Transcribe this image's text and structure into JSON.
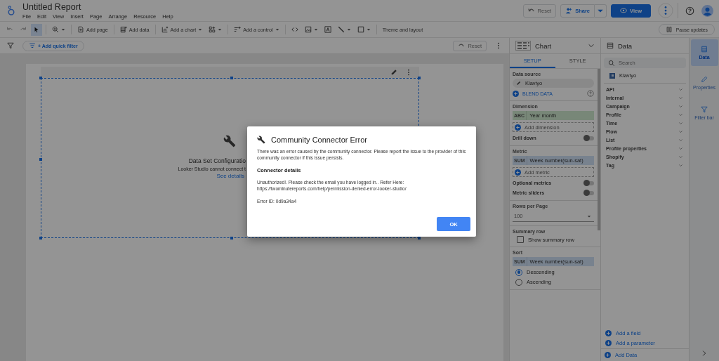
{
  "app": {
    "title": "Untitled Report",
    "menu": [
      "File",
      "Edit",
      "View",
      "Insert",
      "Page",
      "Arrange",
      "Resource",
      "Help"
    ],
    "reset": "Reset",
    "share": "Share",
    "view": "View"
  },
  "toolbar": {
    "items": [
      {
        "kind": "undo",
        "caret": false,
        "selected": false,
        "disabled": true
      },
      {
        "kind": "redo",
        "caret": false,
        "selected": false,
        "disabled": true
      },
      {
        "kind": "select",
        "caret": false,
        "selected": true,
        "disabled": false
      },
      {
        "kind": "zoom",
        "caret": true,
        "selected": false,
        "disabled": false
      },
      {
        "kind": "add_page",
        "label": "Add page",
        "caret": false,
        "selected": false,
        "disabled": false
      },
      {
        "kind": "add_data",
        "label": "Add data",
        "caret": false,
        "selected": false,
        "disabled": false
      },
      {
        "kind": "add_chart",
        "label": "Add a chart",
        "caret": true,
        "selected": false,
        "disabled": false
      },
      {
        "kind": "community",
        "caret": true,
        "selected": false,
        "disabled": false
      },
      {
        "kind": "add_control",
        "label": "Add a control",
        "caret": true,
        "selected": false,
        "disabled": false
      },
      {
        "kind": "embed",
        "caret": false,
        "selected": false,
        "disabled": false
      },
      {
        "kind": "image",
        "caret": true,
        "selected": false,
        "disabled": false
      },
      {
        "kind": "text",
        "caret": false,
        "selected": false,
        "disabled": false
      },
      {
        "kind": "line",
        "caret": true,
        "selected": false,
        "disabled": false
      },
      {
        "kind": "shape",
        "caret": true,
        "selected": false,
        "disabled": false
      },
      {
        "kind": "theme",
        "label": "Theme and layout",
        "caret": false,
        "selected": false,
        "disabled": false
      }
    ],
    "pause": "Pause updates"
  },
  "filter_bar": {
    "quick_filter": "+ Add quick filter",
    "reset": "Reset"
  },
  "canvas": {
    "chart": {
      "selected": true,
      "title": "Data Set Configuratio",
      "message": "Looker Studio cannot connect t",
      "link": "See details"
    }
  },
  "chart_panel": {
    "title": "Chart",
    "tabs": [
      {
        "label": "SETUP",
        "selected": true
      },
      {
        "label": "STYLE",
        "selected": false
      }
    ],
    "sections": [
      {
        "kind": "data_source",
        "heading": "Data source",
        "source": "Klaviyo",
        "blend": "BLEND DATA"
      },
      {
        "kind": "fields",
        "heading": "Dimension",
        "chips": [
          {
            "type": "ABC",
            "label": "Year month",
            "color": "#788778"
          }
        ],
        "add": "Add dimension",
        "toggles": [
          {
            "label": "Drill down",
            "on": false
          }
        ]
      },
      {
        "kind": "fields",
        "heading": "Metric",
        "chips": [
          {
            "type": "SUM",
            "label": "Week number(sun-sat)",
            "color": "#78828e"
          }
        ],
        "add": "Add metric",
        "toggles": [
          {
            "label": "Optional metrics",
            "on": false
          },
          {
            "label": "Metric sliders",
            "on": false
          }
        ]
      },
      {
        "kind": "select",
        "heading": "Rows per Page",
        "value": "100"
      },
      {
        "kind": "checkbox",
        "heading": "Summary row",
        "label": "Show summary row",
        "checked": false
      },
      {
        "kind": "sort",
        "heading": "Sort",
        "chip": {
          "type": "SUM",
          "label": "Week number(sun-sat)",
          "color": "#78828e"
        },
        "options": [
          {
            "label": "Descending",
            "selected": true
          },
          {
            "label": "Ascending",
            "selected": false
          }
        ]
      }
    ]
  },
  "data_panel": {
    "title": "Data",
    "search": {
      "placeholder": "Search"
    },
    "source": "Klaviyo",
    "groups": [
      {
        "label": "API",
        "expanded": false
      },
      {
        "label": "Internal",
        "expanded": false
      },
      {
        "label": "Campaign",
        "expanded": false
      },
      {
        "label": "Profile",
        "expanded": false
      },
      {
        "label": "Time",
        "expanded": false
      },
      {
        "label": "Flow",
        "expanded": false
      },
      {
        "label": "List",
        "expanded": false
      },
      {
        "label": "Profile properties",
        "expanded": false
      },
      {
        "label": "Shopify",
        "expanded": false
      },
      {
        "label": "Tag",
        "expanded": false
      }
    ],
    "actions": [
      "Add a field",
      "Add a parameter"
    ],
    "add_data": "Add Data"
  },
  "rail": [
    {
      "kind": "data",
      "label": "Data",
      "selected": true
    },
    {
      "kind": "properties",
      "label": "Properties",
      "selected": false
    },
    {
      "kind": "filter",
      "label": "Filter bar",
      "selected": false
    }
  ],
  "dialog": {
    "title": "Community Connector Error",
    "message": "There was an error caused by the community connector. Please report the issue to the provider of this community connector if this issue persists.",
    "details_heading": "Connector details",
    "details_lines": [
      "Unauthorized!. Please check the email you have logged in.. Refer Here:",
      "https://twominutereports.com/help/permission-denied-error-looker-studio/"
    ],
    "error_id": "Error ID: 0d9a34a4",
    "ok": "OK"
  }
}
